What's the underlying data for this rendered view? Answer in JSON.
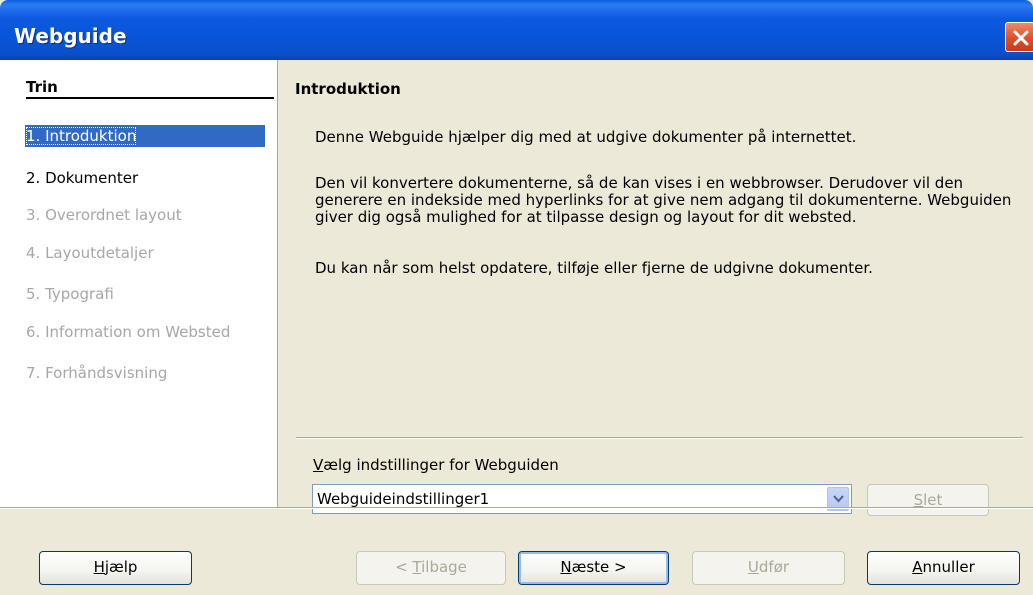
{
  "window": {
    "title": "Webguide"
  },
  "sidebar": {
    "title": "Trin",
    "steps": [
      {
        "label": "1. Introduktion",
        "state": "selected"
      },
      {
        "label": "2. Dokumenter",
        "state": "enabled"
      },
      {
        "label": "3. Overordnet layout",
        "state": "disabled"
      },
      {
        "label": "4. Layoutdetaljer",
        "state": "disabled"
      },
      {
        "label": "5. Typografi",
        "state": "disabled"
      },
      {
        "label": "6. Information om Websted",
        "state": "disabled"
      },
      {
        "label": "7. Forhåndsvisning",
        "state": "disabled"
      }
    ]
  },
  "main": {
    "title": "Introduktion",
    "paragraphs": [
      "Denne Webguide hjælper dig med at udgive dokumenter på internettet.",
      "Den vil konvertere dokumenterne, så de kan vises i en webbrowser. Derudover vil den generere en indekside med hyperlinks for at give nem adgang til dokumenterne. Webguiden giver dig også mulighed for at tilpasse design og layout for dit websted.",
      "Du kan når som helst opdatere, tilføje eller fjerne de udgivne dokumenter."
    ],
    "settings": {
      "label_acc": "V",
      "label_rest": "ælg indstillinger for Webguiden",
      "selected_value": "Webguideindstillinger1",
      "delete": {
        "acc": "S",
        "rest": "let",
        "enabled": false
      }
    }
  },
  "buttons": {
    "help": {
      "acc": "H",
      "rest": "jælp",
      "enabled": true
    },
    "back": {
      "pre": "< ",
      "acc": "T",
      "rest": "ilbage",
      "enabled": false
    },
    "next": {
      "acc": "N",
      "rest": "æste >",
      "enabled": true
    },
    "finish": {
      "acc": "U",
      "rest": "dfør",
      "enabled": false
    },
    "cancel": {
      "acc": "A",
      "rest": "nnuller",
      "enabled": true
    }
  },
  "colors": {
    "selection": "#316ac5",
    "disabled_text": "#a7a6aa",
    "titlebar": "#0854d6"
  },
  "icons": {
    "close": "close-icon",
    "dropdown": "chevron-down-icon"
  }
}
